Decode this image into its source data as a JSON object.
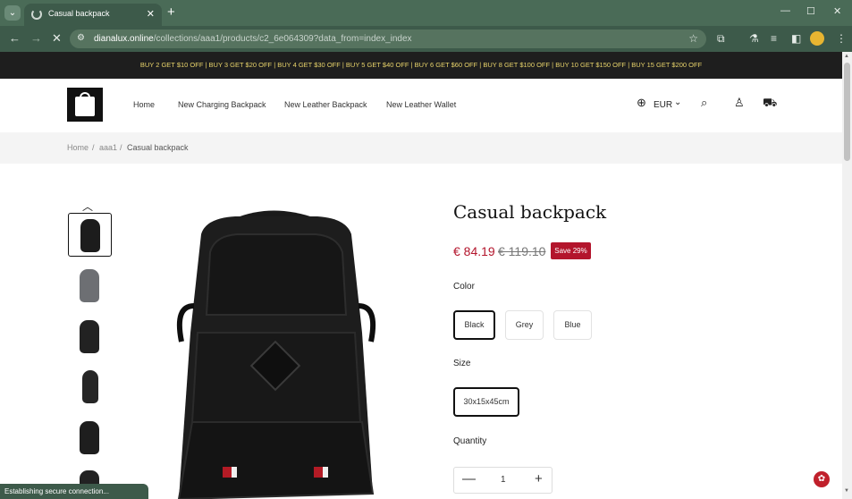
{
  "browser": {
    "tab_list_icon": "chevron-down-icon",
    "tab_title": "Casual backpack",
    "url_host": "dianalux.online",
    "url_path": "/collections/aaa1/products/c2_6e064309?data_from=index_index",
    "status_text": "Establishing secure connection..."
  },
  "announcement": "BUY 2 GET $10 OFF | BUY 3 GET $20 OFF | BUY 4 GET $30 OFF | BUY 5 GET $40 OFF | BUY 6 GET $60 OFF | BUY 8 GET $100 OFF | BUY 10 GET $150 OFF | BUY 15 GET $200 OFF",
  "nav": {
    "links": [
      "Home",
      "New Charging Backpack",
      "New Leather Backpack",
      "New Leather Wallet"
    ],
    "currency": "EUR"
  },
  "breadcrumb": [
    "Home",
    "aaa1",
    "Casual backpack"
  ],
  "product": {
    "title": "Casual backpack",
    "price": "€ 84.19",
    "compare_price": "€ 119.10",
    "save_badge": "Save 29%",
    "color_label": "Color",
    "colors": [
      "Black",
      "Grey",
      "Blue"
    ],
    "selected_color": "Black",
    "size_label": "Size",
    "sizes": [
      "30x15x45cm"
    ],
    "quantity_label": "Quantity",
    "quantity": "1"
  },
  "colors": {
    "chrome_dark": "#3d5a4a",
    "accent_red": "#b3152c",
    "announce_text": "#e9d46b"
  }
}
